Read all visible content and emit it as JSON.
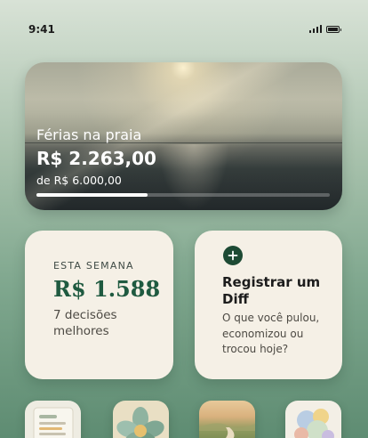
{
  "status_bar": {
    "time": "9:41",
    "signal_icon": "cellular-signal-icon",
    "battery_icon": "battery-icon"
  },
  "goal": {
    "title": "Férias na praia",
    "amount": "R$ 2.263,00",
    "target": "de R$ 6.000,00",
    "progress_fraction": 0.38,
    "image": "beach-sunset-image"
  },
  "week_card": {
    "label": "ESTA SEMANA",
    "amount": "R$ 1.588",
    "description": "7 decisões melhores"
  },
  "diff_card": {
    "icon": "plus-icon",
    "title": "Registrar um Diff",
    "description": "O que você pulou, economizou ou trocou hoje?"
  },
  "shortcuts": [
    {
      "icon": "notes-icon"
    },
    {
      "icon": "flower-icon"
    },
    {
      "icon": "road-landscape-icon"
    },
    {
      "icon": "bubbles-icon"
    }
  ],
  "colors": {
    "accent_green": "#1f5a40",
    "card_background": "#f5f0e6",
    "plus_button": "#1d4a34"
  }
}
